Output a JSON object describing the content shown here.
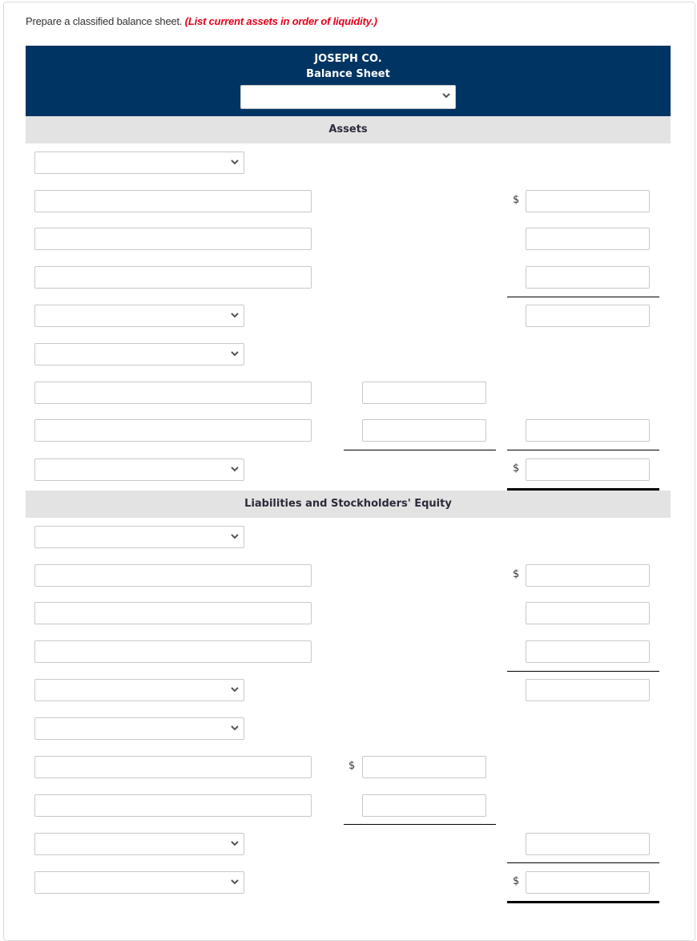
{
  "instruction": {
    "text": "Prepare a classified balance sheet.",
    "note": "(List current assets in order of liquidity.)"
  },
  "header": {
    "company": "JOSEPH CO.",
    "statement": "Balance Sheet",
    "date_select": {
      "selected": ""
    }
  },
  "sections": {
    "assets": "Assets",
    "liabilities_equity": "Liabilities and Stockholders' Equity"
  },
  "currency_symbol": "$",
  "colors": {
    "header_bg": "#003462",
    "band_bg": "#e3e3e3",
    "note_red": "#e3001b"
  }
}
